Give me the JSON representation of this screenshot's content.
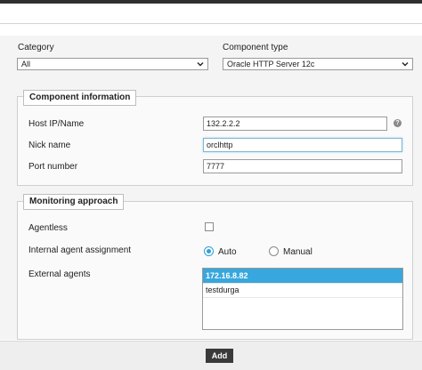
{
  "form": {
    "category": {
      "label": "Category",
      "value": "All"
    },
    "component_type": {
      "label": "Component type",
      "value": "Oracle HTTP Server 12c"
    }
  },
  "component_info": {
    "legend": "Component information",
    "host": {
      "label": "Host IP/Name",
      "value": "132.2.2.2"
    },
    "nick": {
      "label": "Nick name",
      "value": "orclhttp"
    },
    "port": {
      "label": "Port number",
      "value": "7777"
    }
  },
  "monitoring": {
    "legend": "Monitoring approach",
    "agentless": {
      "label": "Agentless",
      "checked": false
    },
    "internal_agent": {
      "label": "Internal agent assignment",
      "options": [
        "Auto",
        "Manual"
      ],
      "selected": "Auto"
    },
    "external_agents": {
      "label": "External agents",
      "items": [
        "172.16.8.82",
        "testdurga"
      ],
      "selected": "172.16.8.82"
    }
  },
  "footer": {
    "add_label": "Add"
  },
  "colors": {
    "accent": "#38a7dd",
    "button": "#3a3a3a"
  }
}
